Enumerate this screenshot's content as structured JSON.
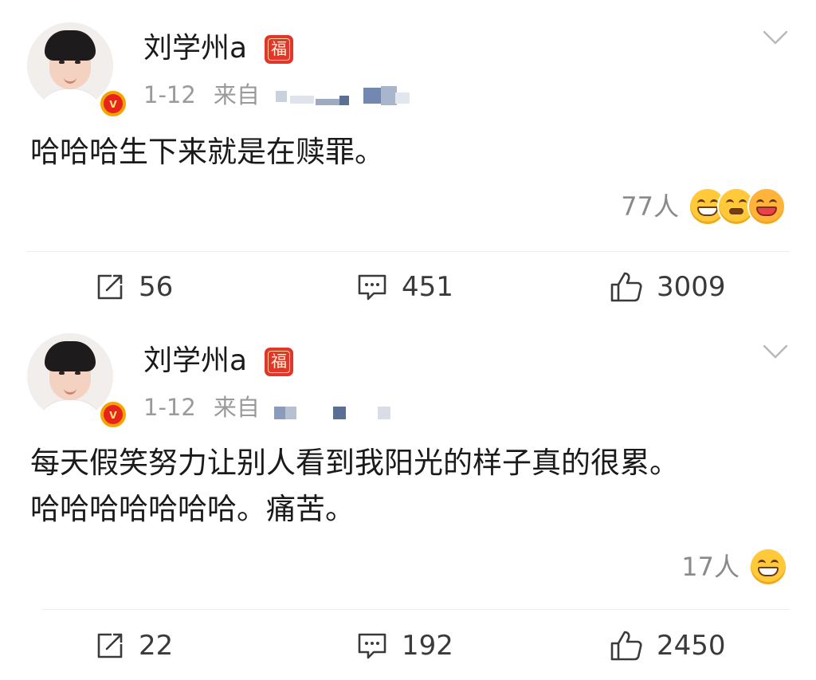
{
  "posts": [
    {
      "username": "刘学州a",
      "badge_char": "福",
      "verified_glyph": "v",
      "date": "1-12",
      "source_prefix": "来自",
      "content_lines": [
        "哈哈哈生下来就是在赎罪。"
      ],
      "reaction_count": "77人",
      "reaction_emojis": [
        "laugh-emoji",
        "shy-emoji",
        "hug-emoji"
      ],
      "actions": {
        "repost": "56",
        "comment": "451",
        "like": "3009"
      }
    },
    {
      "username": "刘学州a",
      "badge_char": "福",
      "verified_glyph": "v",
      "date": "1-12",
      "source_prefix": "来自",
      "content_lines": [
        "每天假笑努力让别人看到我阳光的样子真的很累。",
        "哈哈哈哈哈哈哈。痛苦。"
      ],
      "reaction_count": "17人",
      "reaction_emojis": [
        "laugh-emoji"
      ],
      "actions": {
        "repost": "22",
        "comment": "192",
        "like": "2450"
      }
    }
  ],
  "colors": {
    "text": "#1a1a1a",
    "meta": "#9a9a9a",
    "badge_red": "#e2362b",
    "verified_gold": "#f5a300",
    "emoji_yellow": "#ffc93a",
    "divider": "#ececec"
  }
}
